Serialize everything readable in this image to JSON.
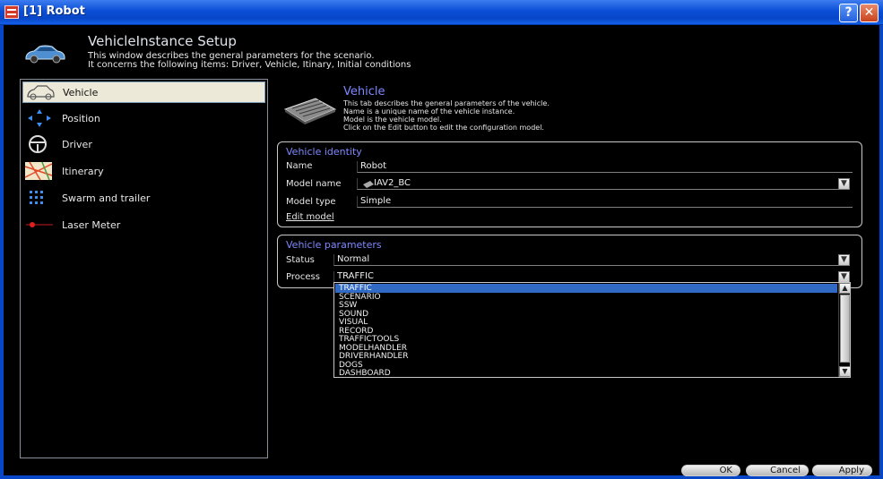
{
  "window": {
    "title": "[1] Robot"
  },
  "header": {
    "title": "VehicleInstance Setup",
    "desc_line1": "This window describes the general parameters for the scenario.",
    "desc_line2": "It concerns the following items: Driver, Vehicle, Itinary, Initial conditions"
  },
  "sidebar": {
    "items": [
      {
        "label": "Vehicle",
        "icon": "car-icon"
      },
      {
        "label": "Position",
        "icon": "arrows-icon"
      },
      {
        "label": "Driver",
        "icon": "steering-wheel-icon"
      },
      {
        "label": "Itinerary",
        "icon": "map-icon"
      },
      {
        "label": "Swarm and trailer",
        "icon": "swarm-icon"
      },
      {
        "label": "Laser Meter",
        "icon": "laser-icon"
      }
    ],
    "selected_index": 0
  },
  "vehicle_tab": {
    "title": "Vehicle",
    "desc": [
      "This tab describes the general parameters of the vehicle.",
      "Name is a unique name of the vehicle instance.",
      "Model is the vehicle model.",
      "Click on the Edit button to edit the configuration model."
    ]
  },
  "identity": {
    "title": "Vehicle identity",
    "name_label": "Name",
    "name_value": "Robot",
    "model_name_label": "Model name",
    "model_name_value": "IAV2_BC",
    "model_type_label": "Model type",
    "model_type_value": "Simple",
    "edit_model": "Edit model"
  },
  "parameters": {
    "title": "Vehicle parameters",
    "status_label": "Status",
    "status_value": "Normal",
    "process_label": "Process",
    "process_value": "TRAFFIC",
    "process_options": [
      "TRAFFIC",
      "SCENARIO",
      "SSW",
      "SOUND",
      "VISUAL",
      "RECORD",
      "TRAFFICTOOLS",
      "MODELHANDLER",
      "DRIVERHANDLER",
      "DOGS",
      "DASHBOARD"
    ]
  },
  "buttons": {
    "ok": "OK",
    "cancel": "Cancel",
    "apply": "Apply"
  },
  "colors": {
    "titlebar": "#0846c8",
    "accent": "#7f88ff",
    "selection": "#316ac5"
  }
}
